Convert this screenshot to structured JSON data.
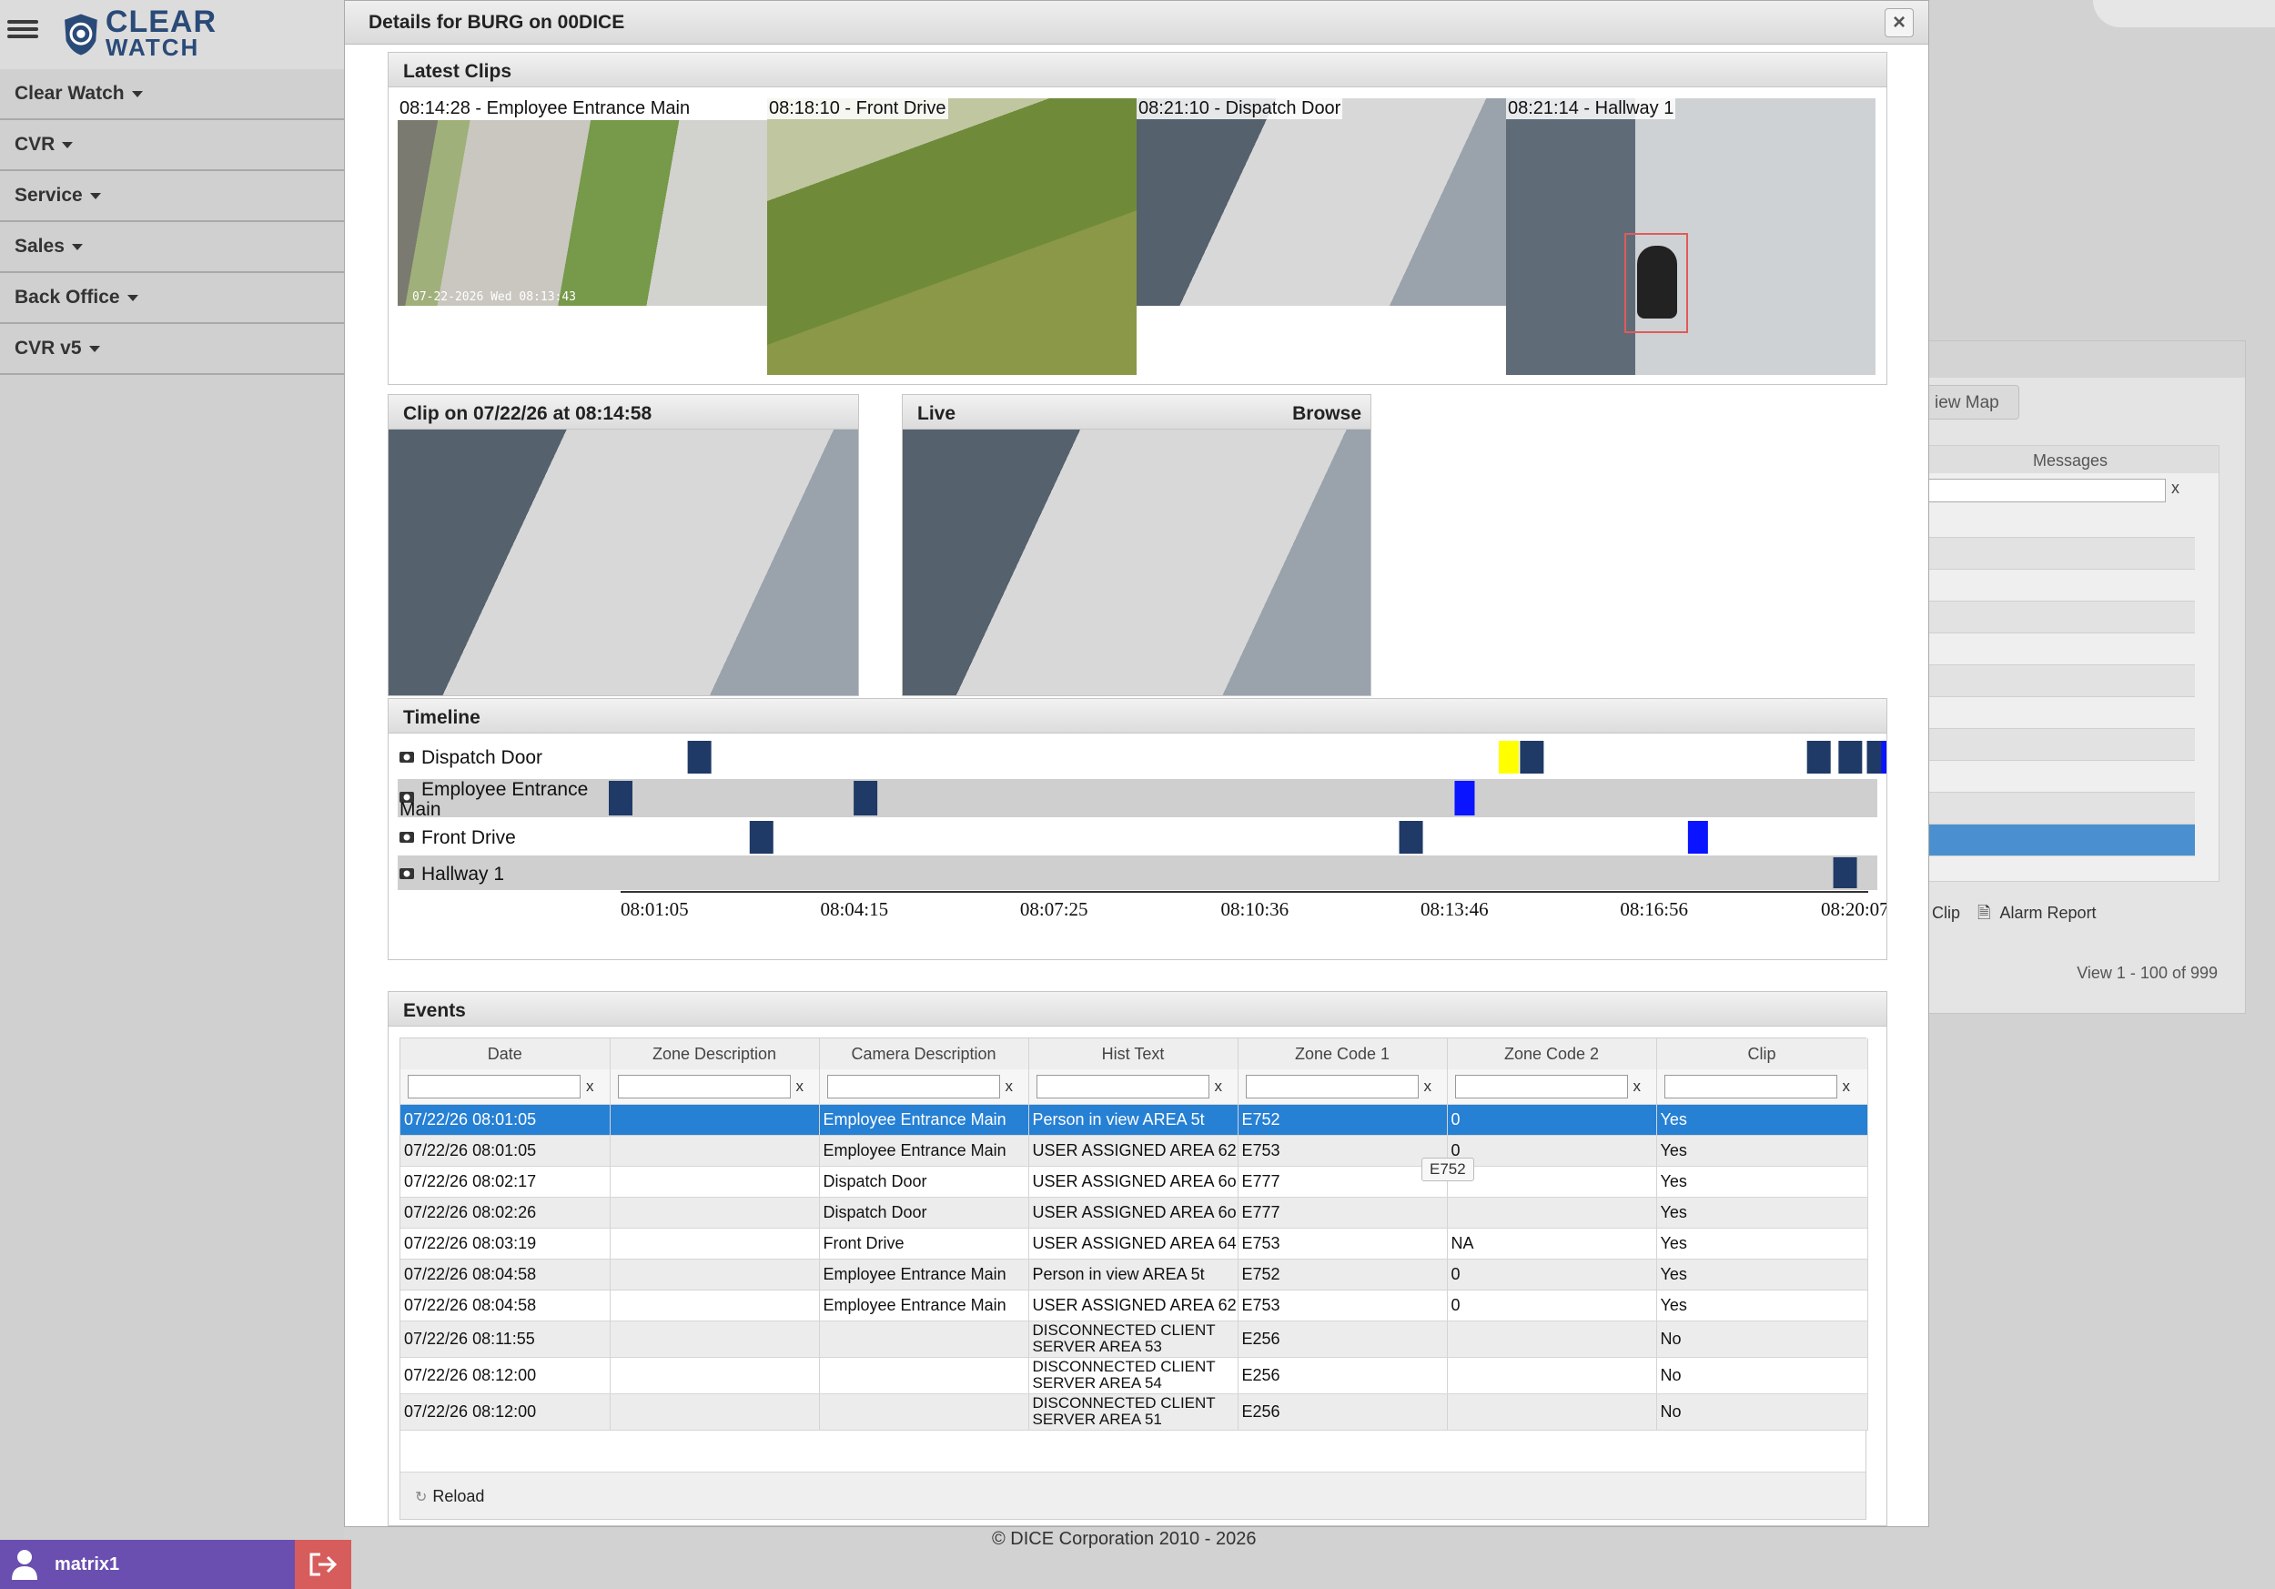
{
  "logo": {
    "line1": "CLEAR",
    "line2": "WATCH"
  },
  "nav": [
    {
      "label": "Clear Watch"
    },
    {
      "label": "CVR"
    },
    {
      "label": "Service"
    },
    {
      "label": "Sales"
    },
    {
      "label": "Back Office"
    },
    {
      "label": "CVR v5"
    }
  ],
  "user": {
    "name": "matrix1"
  },
  "footer": {
    "copyright": "© DICE Corporation 2010 - 2026"
  },
  "background_panel": {
    "view_map": "iew Map",
    "messages_header": "Messages",
    "filter_clear": "x",
    "links": {
      "clip": "Clip",
      "alarm_report": "Alarm Report"
    },
    "pager": "View 1 - 100 of 999"
  },
  "modal": {
    "title": "Details for BURG on 00DICE",
    "close": "×",
    "latest_clips": {
      "title": "Latest Clips",
      "clips": [
        {
          "label": "08:14:28 - Employee Entrance Main",
          "stamp": "07-22-2026 Wed 08:13:43"
        },
        {
          "label": "08:18:10 - Front Drive"
        },
        {
          "label": "08:21:10 - Dispatch Door"
        },
        {
          "label": "08:21:14 - Hallway 1"
        }
      ]
    },
    "clip_panel": {
      "title": "Clip on 07/22/26 at 08:14:58"
    },
    "live_panel": {
      "title": "Live",
      "browse": "Browse"
    },
    "timeline": {
      "title": "Timeline",
      "cameras": [
        "Dispatch Door",
        "Employee Entrance Main",
        "Front Drive",
        "Hallway 1"
      ],
      "ticks": [
        "08:01:05",
        "08:04:15",
        "08:07:25",
        "08:10:36",
        "08:13:46",
        "08:16:56",
        "08:20:07"
      ],
      "colors": {
        "event": "#1f3a66",
        "selected": "#0a14ff",
        "alarm": "#ffff00"
      },
      "events": [
        {
          "camera": 0,
          "time": "08:02:20",
          "kind": "event"
        },
        {
          "camera": 0,
          "time": "08:15:10",
          "kind": "alarm"
        },
        {
          "camera": 0,
          "time": "08:15:32",
          "kind": "event"
        },
        {
          "camera": 0,
          "time": "08:20:05",
          "kind": "event"
        },
        {
          "camera": 0,
          "time": "08:20:35",
          "kind": "event"
        },
        {
          "camera": 0,
          "time": "08:21:02",
          "kind": "event"
        },
        {
          "camera": 0,
          "time": "08:21:14",
          "kind": "selected"
        },
        {
          "camera": 1,
          "time": "08:01:05",
          "kind": "event"
        },
        {
          "camera": 1,
          "time": "08:04:58",
          "kind": "event"
        },
        {
          "camera": 1,
          "time": "08:14:28",
          "kind": "selected"
        },
        {
          "camera": 2,
          "time": "08:03:19",
          "kind": "event"
        },
        {
          "camera": 2,
          "time": "08:13:37",
          "kind": "event"
        },
        {
          "camera": 2,
          "time": "08:18:10",
          "kind": "selected"
        },
        {
          "camera": 3,
          "time": "08:20:30",
          "kind": "event"
        },
        {
          "camera": 3,
          "time": "08:21:30",
          "kind": "selected"
        }
      ]
    },
    "events": {
      "title": "Events",
      "columns": [
        "Date",
        "Zone Description",
        "Camera Description",
        "Hist Text",
        "Zone Code 1",
        "Zone Code 2",
        "Clip"
      ],
      "filter_clear": "x",
      "rows": [
        {
          "date": "07/22/26 08:01:05",
          "zone": "",
          "camera": "Employee Entrance Main",
          "hist": "Person in view AREA 5t",
          "code1": "E752",
          "code2": "0",
          "clip": "Yes"
        },
        {
          "date": "07/22/26 08:01:05",
          "zone": "",
          "camera": "Employee Entrance Main",
          "hist": "USER ASSIGNED AREA 62",
          "code1": "E753",
          "code2": "0",
          "clip": "Yes"
        },
        {
          "date": "07/22/26 08:02:17",
          "zone": "",
          "camera": "Dispatch Door",
          "hist": "USER ASSIGNED AREA 6o",
          "code1": "E777",
          "code2": "",
          "clip": "Yes"
        },
        {
          "date": "07/22/26 08:02:26",
          "zone": "",
          "camera": "Dispatch Door",
          "hist": "USER ASSIGNED AREA 6o",
          "code1": "E777",
          "code2": "",
          "clip": "Yes"
        },
        {
          "date": "07/22/26 08:03:19",
          "zone": "",
          "camera": "Front Drive",
          "hist": "USER ASSIGNED AREA 64",
          "code1": "E753",
          "code2": "NA",
          "clip": "Yes"
        },
        {
          "date": "07/22/26 08:04:58",
          "zone": "",
          "camera": "Employee Entrance Main",
          "hist": "Person in view AREA 5t",
          "code1": "E752",
          "code2": "0",
          "clip": "Yes"
        },
        {
          "date": "07/22/26 08:04:58",
          "zone": "",
          "camera": "Employee Entrance Main",
          "hist": "USER ASSIGNED AREA 62",
          "code1": "E753",
          "code2": "0",
          "clip": "Yes"
        },
        {
          "date": "07/22/26 08:11:55",
          "zone": "",
          "camera": "",
          "hist": "DISCONNECTED CLIENT SERVER AREA 53",
          "code1": "E256",
          "code2": "",
          "clip": "No"
        },
        {
          "date": "07/22/26 08:12:00",
          "zone": "",
          "camera": "",
          "hist": "DISCONNECTED CLIENT SERVER AREA 54",
          "code1": "E256",
          "code2": "",
          "clip": "No"
        },
        {
          "date": "07/22/26 08:12:00",
          "zone": "",
          "camera": "",
          "hist": "DISCONNECTED CLIENT SERVER AREA 51",
          "code1": "E256",
          "code2": "",
          "clip": "No"
        }
      ],
      "tooltip": "E752",
      "reload": "Reload"
    }
  }
}
